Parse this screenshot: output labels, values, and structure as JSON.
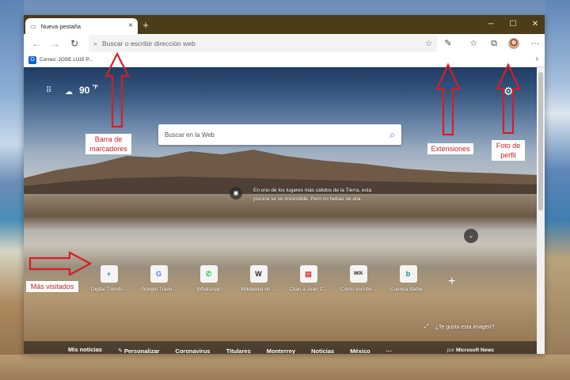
{
  "browser": {
    "tab_title": "Nueva pestaña",
    "tab_close_icon": "close-icon",
    "new_tab_icon": "plus-icon",
    "window_controls": {
      "minimize": "─",
      "maximize": "☐",
      "close": "✕"
    },
    "address_placeholder": "Buscar o escribir dirección web",
    "icons": [
      "back-icon",
      "forward-icon",
      "refresh-icon",
      "search-icon",
      "star-icon",
      "extension-pen-icon",
      "favorites-icon",
      "collections-icon",
      "profile-avatar",
      "more-icon"
    ]
  },
  "favorites_bar": {
    "items": [
      {
        "label": "Correo: JOSE LUIS P..."
      }
    ]
  },
  "newtab": {
    "weather": {
      "temp": "90",
      "unit": "°F"
    },
    "search_placeholder": "Buscar en la Web",
    "image_caption": "En uno de los lugares más cálidos de la Tierra, esta piscina se ve irresistible. Pero no bebas de ella.",
    "image_question": "¿Te gusta esta imagen?",
    "tiles": [
      {
        "label": "Digital Trends...",
        "glyph": "+",
        "color": "#2d9ad8"
      },
      {
        "label": "Google Tradu...",
        "glyph": "G",
        "color": "#4285f4"
      },
      {
        "label": "WhatsApp",
        "glyph": "✆",
        "color": "#25d366"
      },
      {
        "label": "Wikipedia en ...",
        "glyph": "W",
        "color": "#222222"
      },
      {
        "label": "Citan a Juan C...",
        "glyph": "▤",
        "color": "#d23838"
      },
      {
        "label": "Cómo escribir...",
        "glyph": "WIX",
        "color": "#222222"
      },
      {
        "label": "Cuenca Badw...",
        "glyph": "b",
        "color": "#138a8a"
      }
    ],
    "news_tabs": [
      "Mis noticias",
      "Personalizar",
      "Coronavirus",
      "Titulares",
      "Monterrey",
      "Noticias",
      "México",
      "···"
    ],
    "news_provider_prefix": "por",
    "news_provider": "Microsoft News"
  },
  "annotations": {
    "barra": "Barra de marcadores",
    "extensiones": "Extensiones",
    "perfil": "Foto de perfil",
    "mas_visitados": "Más visitados"
  },
  "colors": {
    "annotation": "#c0212a",
    "accent": "#2a6ec8"
  }
}
